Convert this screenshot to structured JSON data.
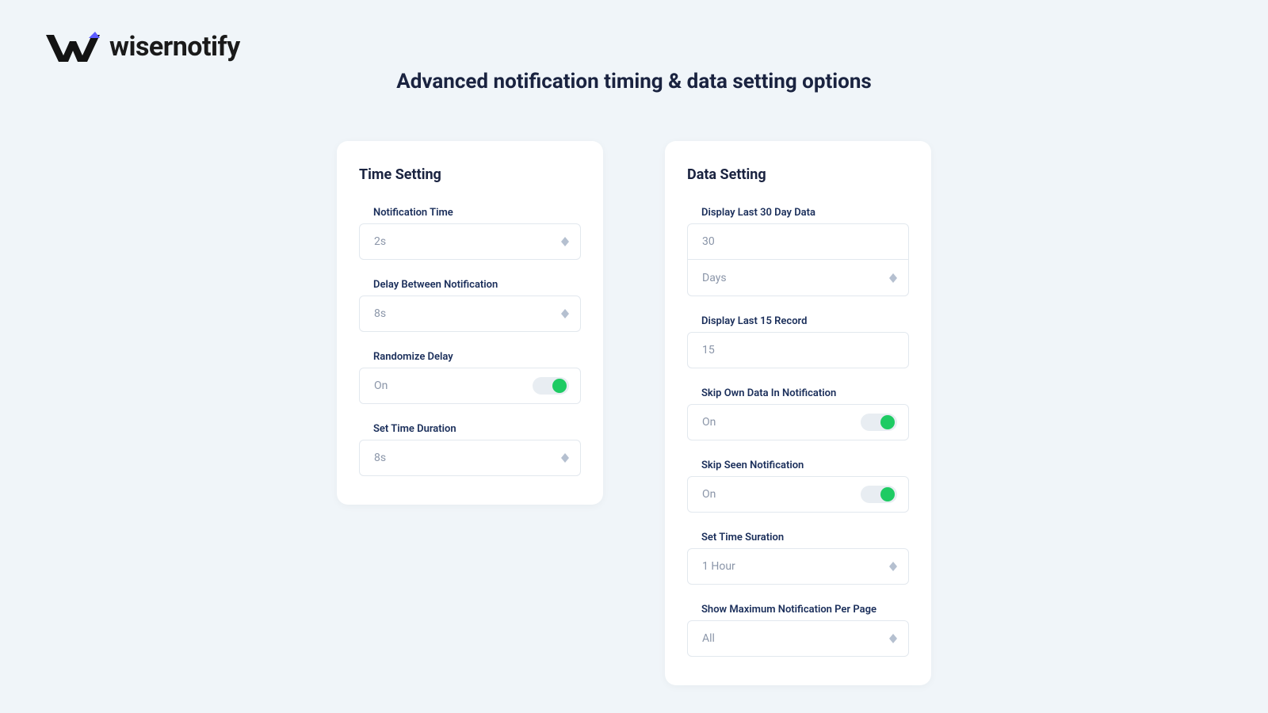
{
  "brand": {
    "name": "wisernotify"
  },
  "page": {
    "title": "Advanced notification timing & data setting options"
  },
  "time_card": {
    "title": "Time Setting",
    "notification_time": {
      "label": "Notification Time",
      "value": "2s"
    },
    "delay_between": {
      "label": "Delay Between Notification",
      "value": "8s"
    },
    "randomize": {
      "label": "Randomize Delay",
      "value": "On"
    },
    "duration": {
      "label": "Set Time Duration",
      "value": "8s"
    }
  },
  "data_card": {
    "title": "Data Setting",
    "last30": {
      "label": "Display Last 30 Day Data",
      "value": "30",
      "unit": "Days"
    },
    "last15": {
      "label": "Display Last 15 Record",
      "value": "15"
    },
    "skip_own": {
      "label": "Skip Own Data In Notification",
      "value": "On"
    },
    "skip_seen": {
      "label": "Skip Seen Notification",
      "value": "On"
    },
    "set_time": {
      "label": "Set Time Suration",
      "value": "1 Hour"
    },
    "max_per_page": {
      "label": "Show Maximum Notification Per Page",
      "value": "All"
    }
  }
}
